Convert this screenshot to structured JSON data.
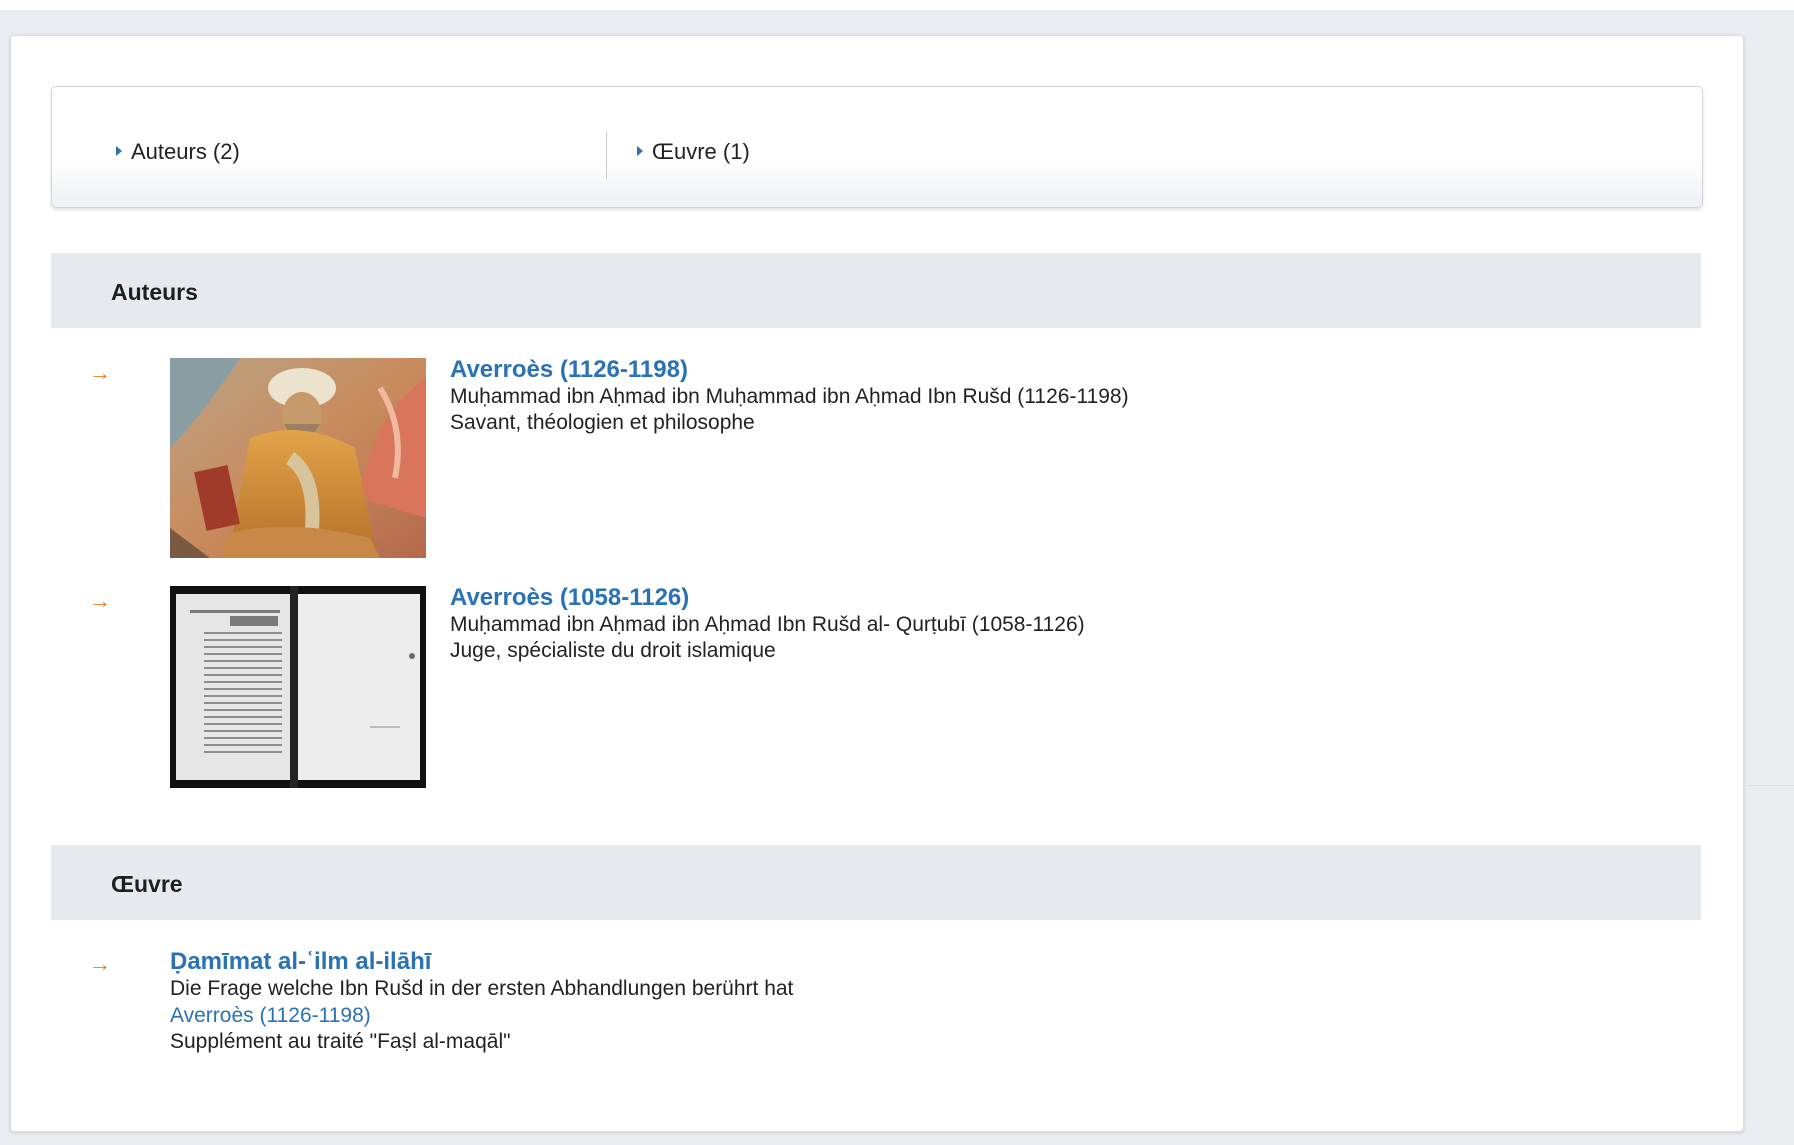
{
  "toc": {
    "authors_label": "Auteurs (2)",
    "works_label": "Œuvre (1)"
  },
  "sections": {
    "authors_title": "Auteurs",
    "works_title": "Œuvre"
  },
  "authors": [
    {
      "name": "Averroès (1126-1198)",
      "full_name": "Muḥammad ibn Aḥmad ibn Muḥammad ibn Aḥmad Ibn Rušd (1126-1198)",
      "description": "Savant, théologien et philosophe",
      "thumbnail": "portrait-painting"
    },
    {
      "name": "Averroès (1058-1126)",
      "full_name": "Muḥammad ibn Aḥmad ibn Aḥmad Ibn Rušd al- Qurṭubī (1058-1126)",
      "description": "Juge, spécialiste du droit islamique",
      "thumbnail": "manuscript-page"
    }
  ],
  "works": [
    {
      "title": "Ḍamīmat al-ʿilm al-ilāhī",
      "subtitle": "Die Frage welche Ibn Rušd in der ersten Abhandlungen berührt hat",
      "author_link": "Averroès (1126-1198)",
      "note": "Supplément au traité \"Faṣl al-maqāl\""
    }
  ],
  "colors": {
    "link": "#2a72b5",
    "arrow": "#e57f1c",
    "header_bg": "#e6eaef"
  },
  "icons": {
    "toc_bullet": "triangle-right-icon",
    "entry_marker": "right-arrow-icon"
  }
}
